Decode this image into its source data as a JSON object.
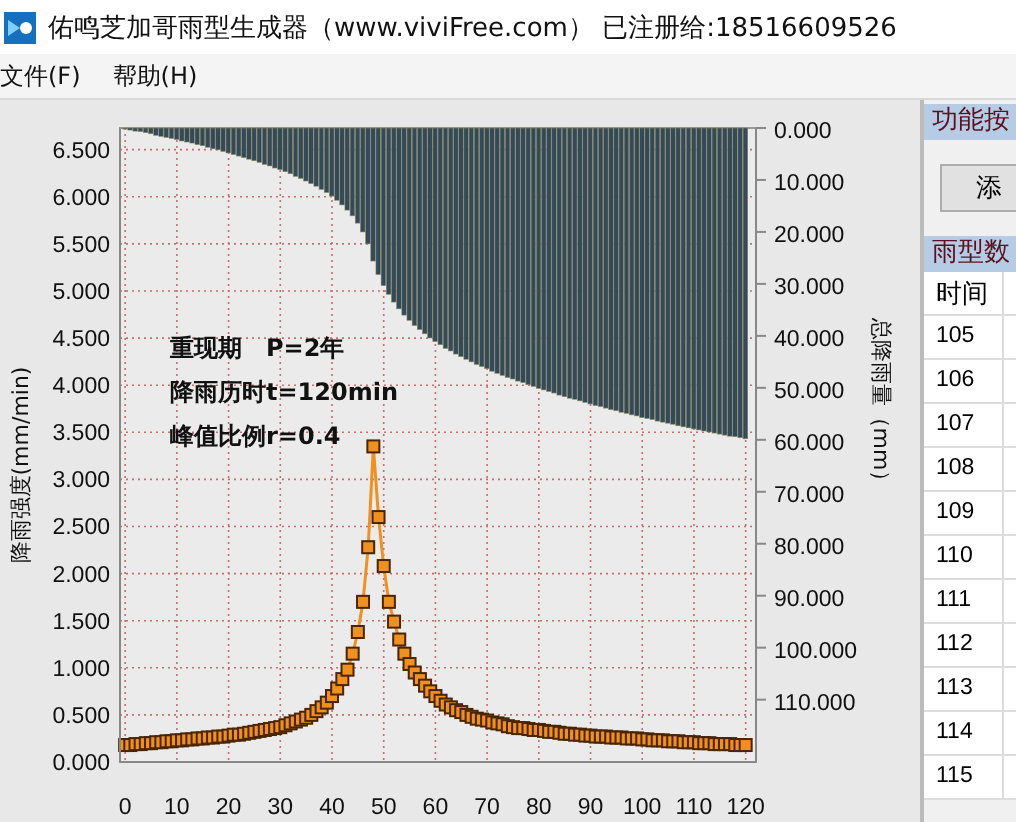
{
  "window": {
    "title": "佑鸣芝加哥雨型生成器（www.viviFree.com） 已注册给:18516609526"
  },
  "menu": [
    "文件(F)",
    "帮助(H)"
  ],
  "chart": {
    "chart_data": {
      "type": "line",
      "grid": true,
      "ylabel": "降雨强度(mm/min)",
      "y2label": "总降雨量（mm）",
      "x": [
        0,
        1,
        2,
        3,
        4,
        5,
        6,
        7,
        8,
        9,
        10,
        11,
        12,
        13,
        14,
        15,
        16,
        17,
        18,
        19,
        20,
        21,
        22,
        23,
        24,
        25,
        26,
        27,
        28,
        29,
        30,
        31,
        32,
        33,
        34,
        35,
        36,
        37,
        38,
        39,
        40,
        41,
        42,
        43,
        44,
        45,
        46,
        47,
        48,
        49,
        50,
        51,
        52,
        53,
        54,
        55,
        56,
        57,
        58,
        59,
        60,
        61,
        62,
        63,
        64,
        65,
        66,
        67,
        68,
        69,
        70,
        71,
        72,
        73,
        74,
        75,
        76,
        77,
        78,
        79,
        80,
        81,
        82,
        83,
        84,
        85,
        86,
        87,
        88,
        89,
        90,
        91,
        92,
        93,
        94,
        95,
        96,
        97,
        98,
        99,
        100,
        101,
        102,
        103,
        104,
        105,
        106,
        107,
        108,
        109,
        110,
        111,
        112,
        113,
        114,
        115,
        116,
        117,
        118,
        119,
        120
      ],
      "xlim": [
        -1,
        122
      ],
      "ylim": [
        0,
        6.73
      ],
      "y2lim": [
        122,
        0
      ],
      "xticks": [
        0,
        10,
        20,
        30,
        40,
        50,
        60,
        70,
        80,
        90,
        100,
        110,
        120
      ],
      "yticks": [
        {
          "value": 0,
          "label": "0.000"
        },
        {
          "value": 0.5,
          "label": "0.500"
        },
        {
          "value": 1,
          "label": "1.000"
        },
        {
          "value": 1.5,
          "label": "1.500"
        },
        {
          "value": 2,
          "label": "2.000"
        },
        {
          "value": 2.5,
          "label": "2.500"
        },
        {
          "value": 3,
          "label": "3.000"
        },
        {
          "value": 3.5,
          "label": "3.500"
        },
        {
          "value": 4,
          "label": "4.000"
        },
        {
          "value": 4.5,
          "label": "4.500"
        },
        {
          "value": 5,
          "label": "5.000"
        },
        {
          "value": 5.5,
          "label": "5.500"
        },
        {
          "value": 6,
          "label": "6.000"
        },
        {
          "value": 6.5,
          "label": "6.500"
        }
      ],
      "y2ticks": [
        {
          "value": 0,
          "label": "0.000"
        },
        {
          "value": 10,
          "label": "10.000"
        },
        {
          "value": 20,
          "label": "20.000"
        },
        {
          "value": 30,
          "label": "30.000"
        },
        {
          "value": 40,
          "label": "40.000"
        },
        {
          "value": 50,
          "label": "50.000"
        },
        {
          "value": 60,
          "label": "60.000"
        },
        {
          "value": 70,
          "label": "70.000"
        },
        {
          "value": 80,
          "label": "80.000"
        },
        {
          "value": 90,
          "label": "90.000"
        },
        {
          "value": 100,
          "label": "100.000"
        },
        {
          "value": 110,
          "label": "110.000"
        }
      ],
      "annotations": [
        "重现期　P=2年",
        "降雨历时t=120min",
        "峰值比例r=0.4"
      ],
      "series": [
        {
          "type": "bar",
          "axis": "y2",
          "color": "#34495a",
          "values": [
            0.2,
            0.4,
            0.6,
            0.7,
            0.9,
            1.1,
            1.4,
            1.6,
            1.8,
            2.0,
            2.2,
            2.5,
            2.7,
            2.9,
            3.2,
            3.4,
            3.7,
            4.0,
            4.2,
            4.5,
            4.8,
            5.1,
            5.4,
            5.7,
            6.0,
            6.3,
            6.6,
            7.0,
            7.3,
            7.7,
            8.0,
            8.4,
            8.8,
            9.3,
            9.7,
            10.2,
            10.7,
            11.2,
            11.8,
            12.4,
            13.1,
            13.9,
            14.8,
            15.8,
            16.9,
            18.3,
            20.0,
            22.3,
            25.6,
            28.2,
            30.3,
            32.0,
            33.5,
            34.8,
            36.0,
            37.0,
            38.0,
            38.8,
            39.6,
            40.4,
            41.1,
            41.7,
            42.4,
            42.9,
            43.5,
            44.0,
            44.5,
            45.0,
            45.5,
            45.9,
            46.3,
            46.8,
            47.2,
            47.6,
            48.0,
            48.3,
            48.7,
            49.0,
            49.4,
            49.7,
            50.1,
            50.4,
            50.7,
            51.0,
            51.4,
            51.7,
            52.0,
            52.2,
            52.5,
            52.8,
            53.1,
            53.4,
            53.6,
            53.9,
            54.2,
            54.4,
            54.7,
            54.9,
            55.2,
            55.4,
            55.7,
            55.9,
            56.1,
            56.4,
            56.6,
            56.8,
            57.0,
            57.3,
            57.5,
            57.7,
            57.9,
            58.1,
            58.3,
            58.5,
            58.7,
            58.9,
            59.1,
            59.3,
            59.4,
            59.6,
            59.8
          ]
        },
        {
          "marker": "square",
          "color": "#f0901e",
          "values": [
            0.18,
            0.18,
            0.19,
            0.19,
            0.2,
            0.2,
            0.21,
            0.21,
            0.22,
            0.22,
            0.23,
            0.23,
            0.24,
            0.24,
            0.25,
            0.25,
            0.26,
            0.26,
            0.27,
            0.27,
            0.28,
            0.29,
            0.29,
            0.3,
            0.31,
            0.32,
            0.33,
            0.34,
            0.35,
            0.36,
            0.37,
            0.39,
            0.41,
            0.43,
            0.45,
            0.47,
            0.5,
            0.54,
            0.58,
            0.63,
            0.7,
            0.78,
            0.88,
            0.98,
            1.15,
            1.38,
            1.7,
            2.28,
            3.35,
            2.6,
            2.08,
            1.7,
            1.49,
            1.3,
            1.15,
            1.04,
            0.95,
            0.88,
            0.81,
            0.75,
            0.7,
            0.65,
            0.61,
            0.58,
            0.55,
            0.53,
            0.5,
            0.48,
            0.46,
            0.45,
            0.44,
            0.42,
            0.41,
            0.4,
            0.38,
            0.37,
            0.36,
            0.36,
            0.35,
            0.34,
            0.34,
            0.33,
            0.32,
            0.32,
            0.31,
            0.3,
            0.3,
            0.29,
            0.29,
            0.28,
            0.28,
            0.27,
            0.27,
            0.27,
            0.26,
            0.26,
            0.26,
            0.25,
            0.25,
            0.25,
            0.24,
            0.24,
            0.23,
            0.23,
            0.23,
            0.22,
            0.22,
            0.22,
            0.21,
            0.21,
            0.21,
            0.2,
            0.2,
            0.2,
            0.19,
            0.19,
            0.19,
            0.19,
            0.18,
            0.18,
            0.18
          ]
        }
      ]
    }
  },
  "side_panel": {
    "function_header": "功能按",
    "add_button": "添",
    "data_header": "雨型数",
    "table": {
      "columns": [
        "时间"
      ],
      "rows": [
        [
          "105"
        ],
        [
          "106"
        ],
        [
          "107"
        ],
        [
          "108"
        ],
        [
          "109"
        ],
        [
          "110"
        ],
        [
          "111"
        ],
        [
          "112"
        ],
        [
          "113"
        ],
        [
          "114"
        ],
        [
          "115"
        ]
      ]
    }
  }
}
